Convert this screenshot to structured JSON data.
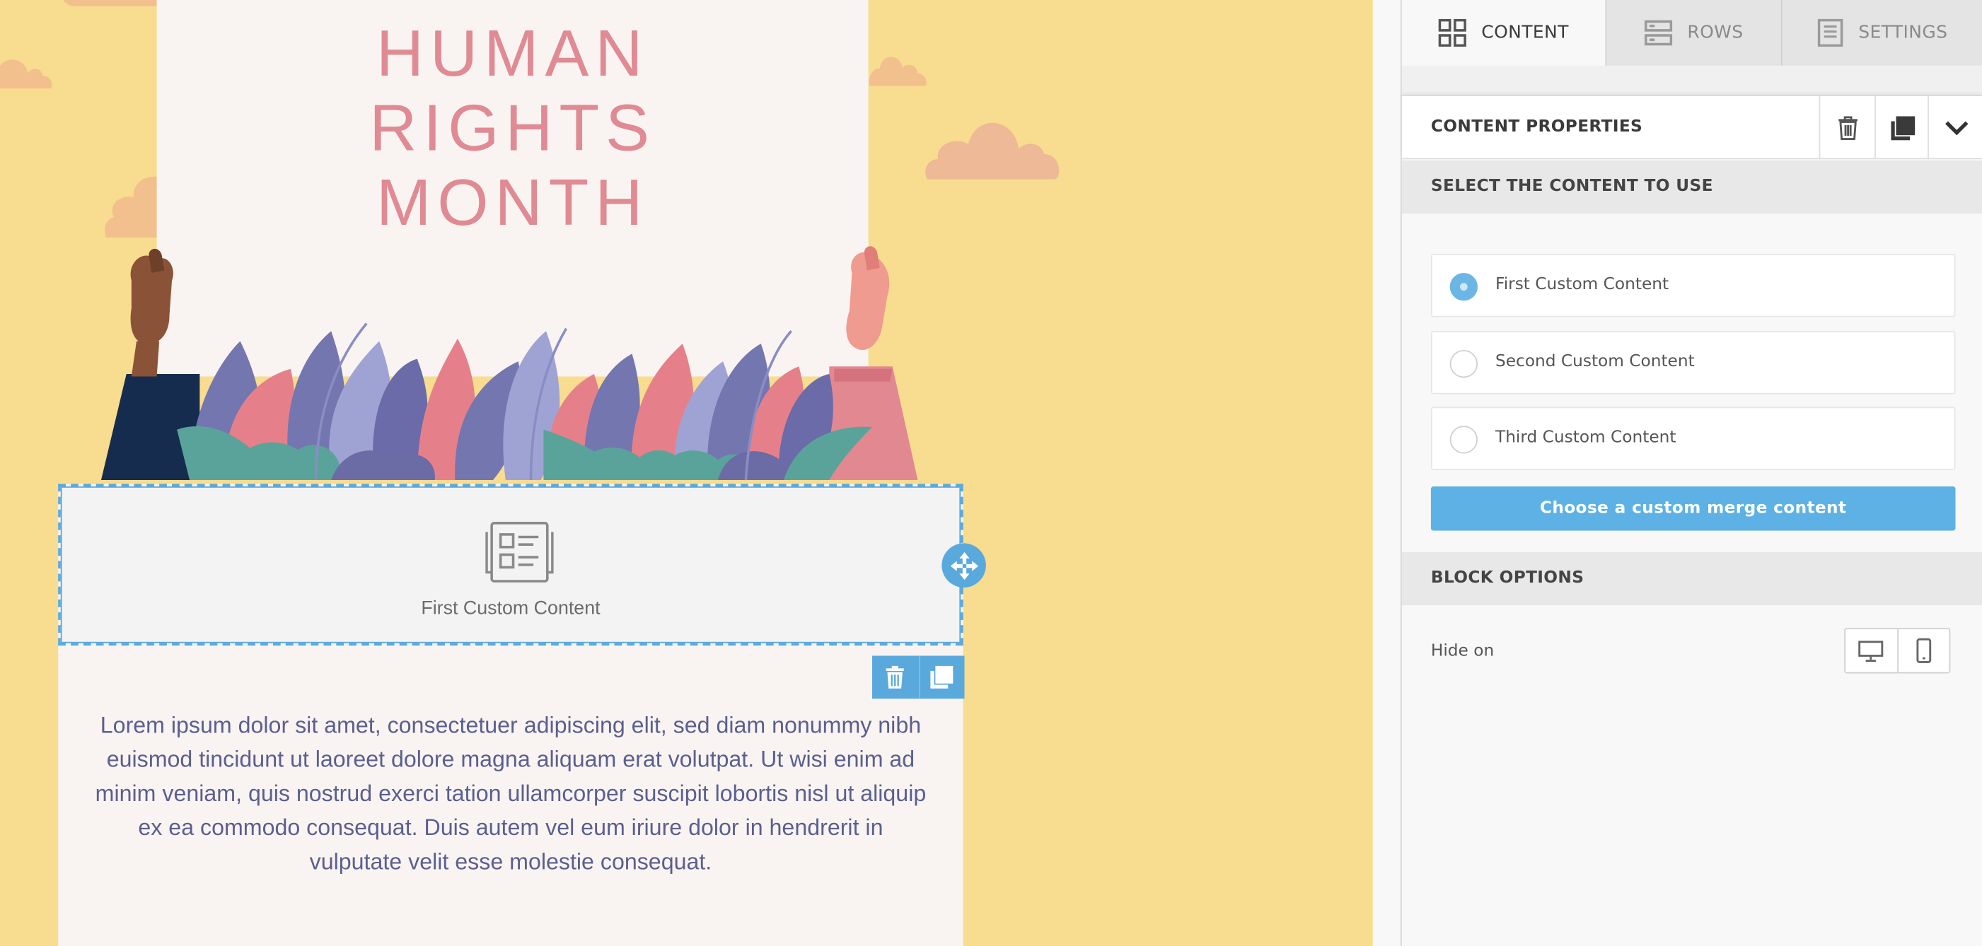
{
  "canvas": {
    "hero_title_lines": [
      "HUMAN",
      "RIGHTS",
      "MONTH"
    ],
    "selected_block_label": "First Custom Content",
    "body_text": "Lorem ipsum dolor sit amet, consectetuer adipiscing elit, sed diam nonummy nibh euismod tincidunt ut laoreet dolore magna aliquam erat volutpat. Ut wisi enim ad minim veniam, quis nostrud exerci tation ullamcorper suscipit lobortis nisl ut aliquip ex ea commodo consequat. Duis autem vel eum iriure dolor in hendrerit in vulputate velit esse molestie consequat."
  },
  "sidebar": {
    "tabs": [
      {
        "label": "CONTENT",
        "icon": "grid-icon",
        "active": true
      },
      {
        "label": "ROWS",
        "icon": "rows-icon",
        "active": false
      },
      {
        "label": "SETTINGS",
        "icon": "settings-doc-icon",
        "active": false
      }
    ],
    "properties_title": "CONTENT PROPERTIES",
    "select_section_title": "SELECT THE CONTENT TO USE",
    "options": [
      {
        "label": "First Custom Content",
        "selected": true
      },
      {
        "label": "Second Custom Content",
        "selected": false
      },
      {
        "label": "Third Custom Content",
        "selected": false
      }
    ],
    "choose_button_label": "Choose a custom merge content",
    "block_options_title": "BLOCK OPTIONS",
    "hide_on_label": "Hide on"
  },
  "colors": {
    "canvas_bg": "#f8dc8f",
    "title_pink": "#e08a94",
    "accent_blue": "#5aa9dd",
    "body_text": "#5b5f8e"
  }
}
